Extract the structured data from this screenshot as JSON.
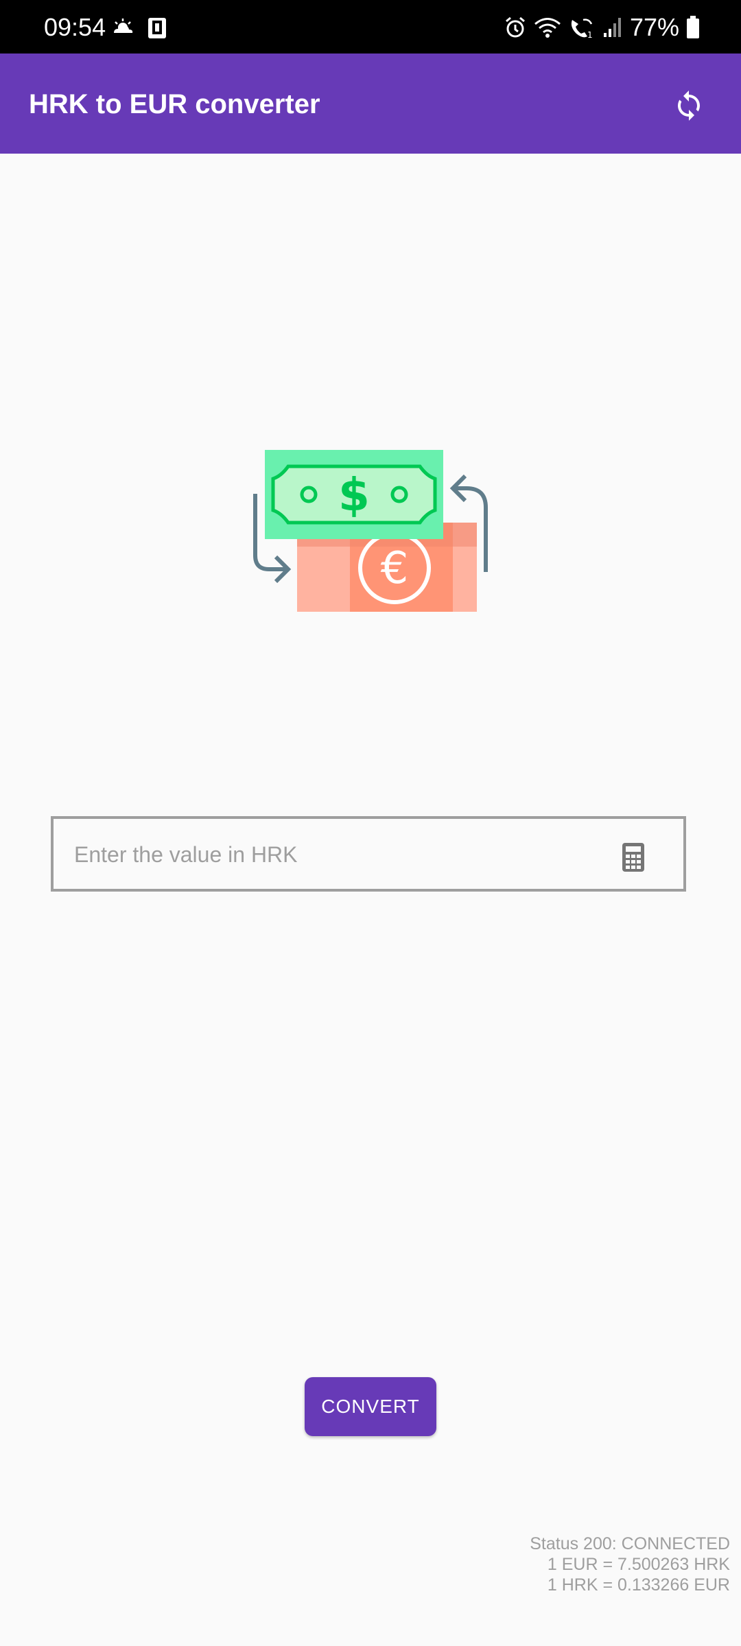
{
  "status_bar": {
    "time": "09:54",
    "battery": "77%",
    "icons_left": [
      "weather-icon",
      "device-icon"
    ],
    "icons_right": [
      "alarm-icon",
      "wifi-icon",
      "wifi-call-icon",
      "signal-icon",
      "battery-icon"
    ]
  },
  "app_bar": {
    "title": "HRK to EUR converter",
    "background": "#673ab7",
    "action_icon": "refresh-icon"
  },
  "illustration": {
    "icon": "currency-exchange-icon"
  },
  "input": {
    "placeholder": "Enter the value in HRK",
    "value": "",
    "icon": "calculator-icon"
  },
  "convert_button": {
    "label": "CONVERT",
    "background": "#673ab7"
  },
  "status_info": {
    "status": "Status 200: CONNECTED",
    "eur_rate": "1 EUR = 7.500263 HRK",
    "hrk_rate": "1 HRK = 0.133266 EUR"
  }
}
